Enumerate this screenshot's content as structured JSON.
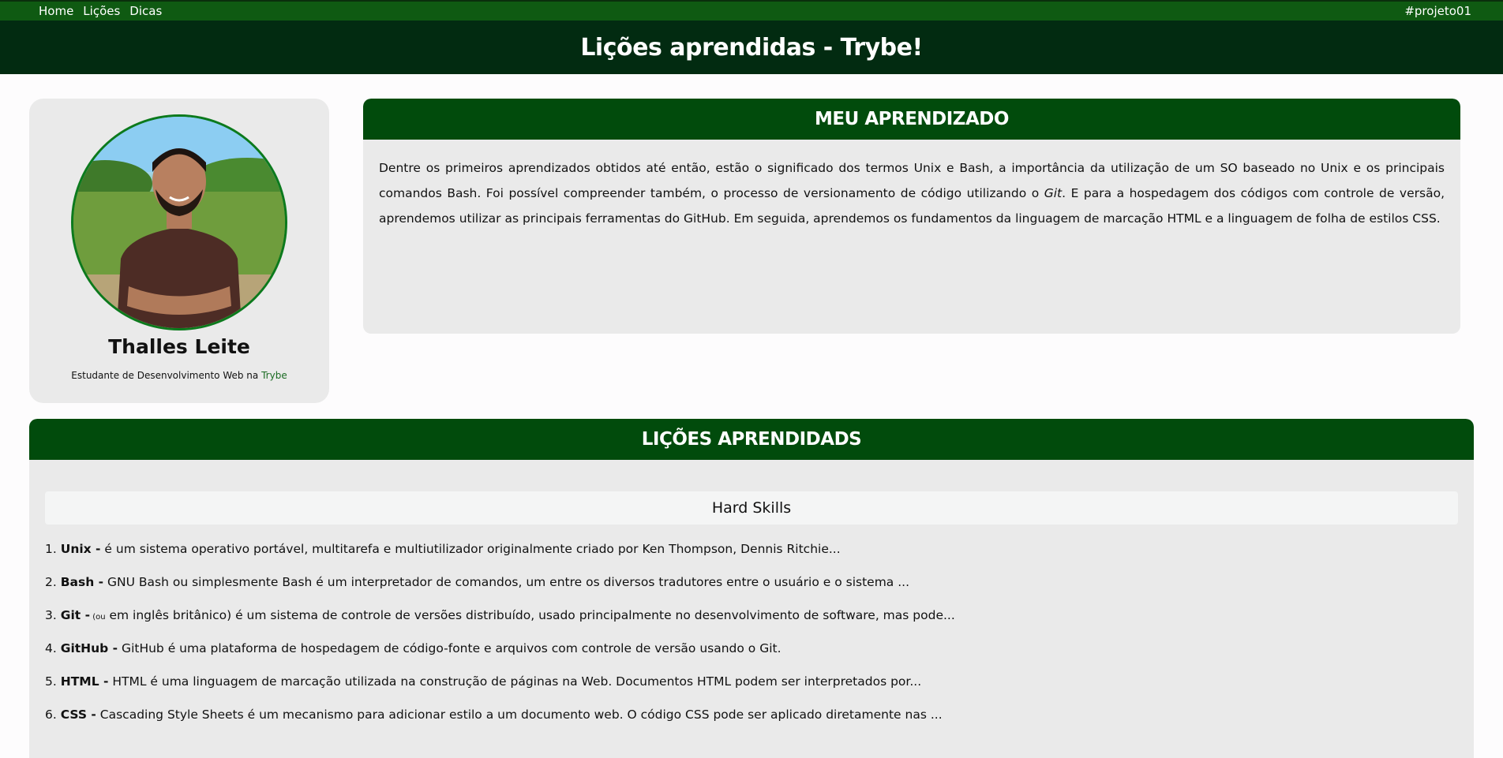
{
  "nav": {
    "links": [
      "Home",
      "Lições",
      "Dicas"
    ],
    "project_tag": "#projeto01"
  },
  "header": {
    "title": "Lições aprendidas - Trybe!"
  },
  "profile": {
    "name": "Thalles Leite",
    "subtitle_prefix": "Estudante de Desenvolvimento Web na ",
    "subtitle_brand": "Trybe"
  },
  "learning": {
    "heading": "MEU APRENDIZADO",
    "text_part1": "Dentre os primeiros aprendizados obtidos até então, estão o significado dos termos Unix e Bash, a importância da utilização de um SO baseado no Unix e os principais comandos Bash. Foi possível compreender também, o processo de versionamento de código utilizando o ",
    "text_italic": "Git",
    "text_part2": ". E para a hospedagem dos códigos com controle de versão, aprendemos utilizar as principais ferramentas do GitHub. Em seguida, aprendemos os fundamentos da linguagem de marcação HTML e a linguagem de folha de estilos CSS."
  },
  "lessons": {
    "heading": "LIÇÕES APRENDIDADS",
    "hard_skills_label": "Hard Skills",
    "items": [
      {
        "num": "1.",
        "term": "Unix -",
        "small": "",
        "desc": " é um sistema operativo portável, multitarefa e multiutilizador originalmente criado por Ken Thompson, Dennis Ritchie..."
      },
      {
        "num": "2.",
        "term": "Bash -",
        "small": "",
        "desc": " GNU Bash ou simplesmente Bash é um interpretador de comandos, um entre os diversos tradutores entre o usuário e o sistema ..."
      },
      {
        "num": "3.",
        "term": "Git -",
        "small": " (ou",
        "desc": " em inglês britânico) é um sistema de controle de versões distribuído, usado principalmente no desenvolvimento de software, mas pode..."
      },
      {
        "num": "4.",
        "term": "GitHub -",
        "small": "",
        "desc": " GitHub é uma plataforma de hospedagem de código-fonte e arquivos com controle de versão usando o Git."
      },
      {
        "num": "5.",
        "term": "HTML -",
        "small": "",
        "desc": " HTML é uma linguagem de marcação utilizada na construção de páginas na Web. Documentos HTML podem ser interpretados por..."
      },
      {
        "num": "6.",
        "term": "CSS -",
        "small": "",
        "desc": " Cascading Style Sheets é um mecanismo para adicionar estilo a um documento web. O código CSS pode ser aplicado diretamente nas ..."
      }
    ]
  }
}
